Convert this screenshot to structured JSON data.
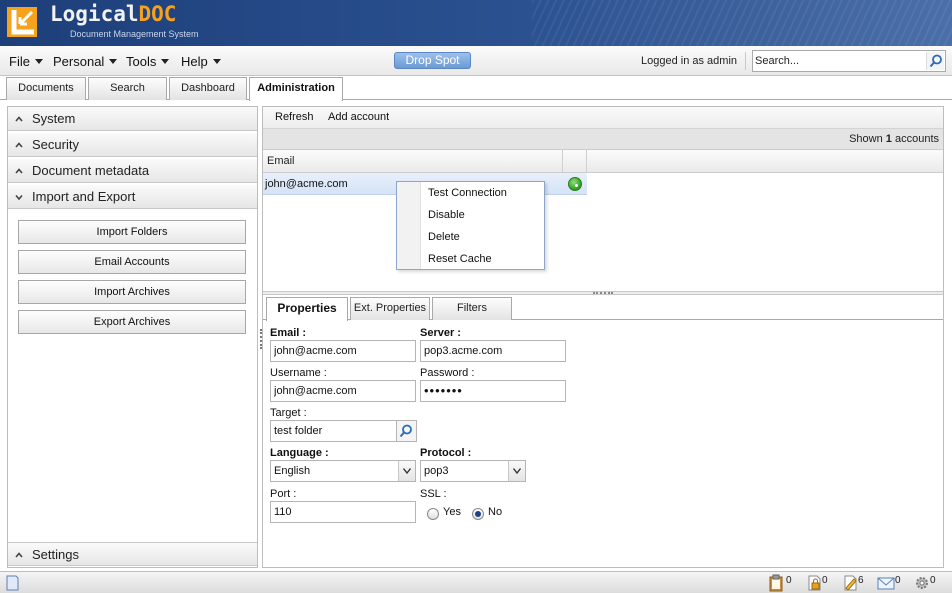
{
  "app": {
    "logo_main": "Logical",
    "logo_accent": "DOC",
    "logo_sub": "Document Management System"
  },
  "menubar": {
    "items": [
      "File",
      "Personal",
      "Tools",
      "Help"
    ],
    "drop_spot": "Drop Spot",
    "logged_in": "Logged in as admin",
    "search_placeholder": "Search..."
  },
  "tabs": [
    "Documents",
    "Search",
    "Dashboard",
    "Administration"
  ],
  "active_tab": "Administration",
  "left_panel": {
    "sections": [
      "System",
      "Security",
      "Document metadata",
      "Import and Export"
    ],
    "expanded_section": "Import and Export",
    "buttons": [
      "Import Folders",
      "Email Accounts",
      "Import Archives",
      "Export Archives"
    ],
    "bottom_section": "Settings"
  },
  "toolbar": {
    "refresh": "Refresh",
    "add_account": "Add account"
  },
  "count": {
    "prefix": "Shown",
    "value": "1",
    "suffix": "accounts"
  },
  "grid": {
    "columns": [
      "Email",
      ""
    ],
    "rows": [
      {
        "email": "john@acme.com",
        "status": "enabled"
      }
    ]
  },
  "context_menu": [
    "Test Connection",
    "Disable",
    "Delete",
    "Reset Cache"
  ],
  "detail_tabs": [
    "Properties",
    "Ext. Properties",
    "Filters"
  ],
  "form": {
    "email_label": "Email :",
    "email_value": "john@acme.com",
    "server_label": "Server :",
    "server_value": "pop3.acme.com",
    "username_label": "Username :",
    "username_value": "john@acme.com",
    "password_label": "Password :",
    "password_value": "•••••••",
    "target_label": "Target :",
    "target_value": "test folder",
    "language_label": "Language :",
    "language_value": "English",
    "protocol_label": "Protocol :",
    "protocol_value": "pop3",
    "port_label": "Port :",
    "port_value": "110",
    "ssl_label": "SSL :",
    "ssl_yes": "Yes",
    "ssl_no": "No",
    "ssl_selected": "No"
  },
  "statusbar": {
    "counts": [
      "0",
      "0",
      "6",
      "0",
      "0"
    ],
    "icons": [
      "clipboard-icon",
      "locked-docs-icon",
      "edit-docs-icon",
      "messages-icon",
      "tasks-gear-icon"
    ]
  },
  "colors": {
    "header_dark": "#1d3f7a",
    "logo_accent": "#f7a21c",
    "status_green": "#2f9a22",
    "selection": "#d4e3f6"
  }
}
